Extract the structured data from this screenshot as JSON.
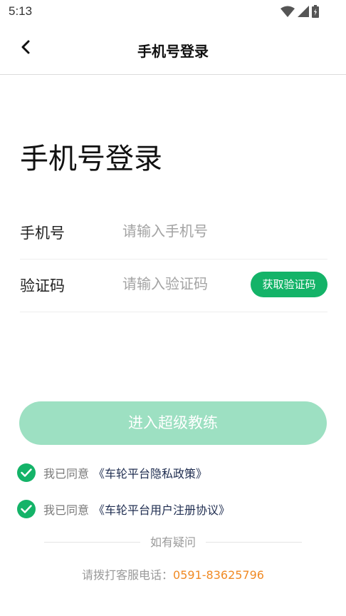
{
  "status_bar": {
    "time": "5:13",
    "icons": [
      "wifi-icon",
      "signal-icon",
      "battery-icon"
    ]
  },
  "nav": {
    "back_icon": "chevron-left-icon",
    "title": "手机号登录"
  },
  "page": {
    "heading": "手机号登录"
  },
  "form": {
    "phone": {
      "label": "手机号",
      "value": "",
      "placeholder": "请输入手机号"
    },
    "code": {
      "label": "验证码",
      "value": "",
      "placeholder": "请输入验证码",
      "get_code_label": "获取验证码"
    }
  },
  "submit": {
    "label": "进入超级教练"
  },
  "agreements": [
    {
      "checked": true,
      "prefix": "我已同意",
      "link": "《车轮平台隐私政策》"
    },
    {
      "checked": true,
      "prefix": "我已同意",
      "link": "《车轮平台用户注册协议》"
    }
  ],
  "help": {
    "divider_text": "如有疑问",
    "hotline_prefix": "请拨打客服电话：",
    "hotline_number": "0591-83625796"
  },
  "colors": {
    "brand_green": "#14b368",
    "disabled_button": "#9de0c2",
    "link_dark": "#1f2d50",
    "hotline_orange": "#f08a24"
  }
}
